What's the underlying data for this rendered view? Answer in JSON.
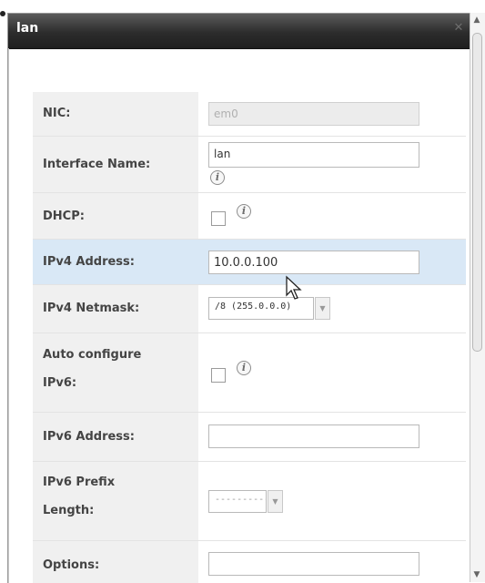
{
  "dialog": {
    "title": "lan",
    "close_glyph": "✕"
  },
  "form": {
    "nic": {
      "label": "NIC:",
      "value": "em0"
    },
    "interface_name": {
      "label": "Interface Name:",
      "value": "lan"
    },
    "dhcp": {
      "label": "DHCP:",
      "checked": false
    },
    "ipv4_address": {
      "label": "IPv4 Address:",
      "value": "10.0.0.100"
    },
    "ipv4_netmask": {
      "label": "IPv4 Netmask:",
      "selected": "/8 (255.0.0.0)"
    },
    "auto_configure_ipv6": {
      "label_line1": "Auto configure",
      "label_line2": "IPv6:",
      "checked": false
    },
    "ipv6_address": {
      "label": "IPv6 Address:",
      "value": ""
    },
    "ipv6_prefix_length": {
      "label_line1": "IPv6 Prefix",
      "label_line2": "Length:",
      "selected": "----------"
    },
    "options": {
      "label": "Options:",
      "value": ""
    }
  },
  "icons": {
    "info": "i",
    "dropdown": "▼",
    "scroll_up": "▲",
    "scroll_down": "▼"
  },
  "colors": {
    "titlebar": "#2c2c2c",
    "highlight_row": "#d9e8f6",
    "label_bg": "#f0f0f0"
  }
}
